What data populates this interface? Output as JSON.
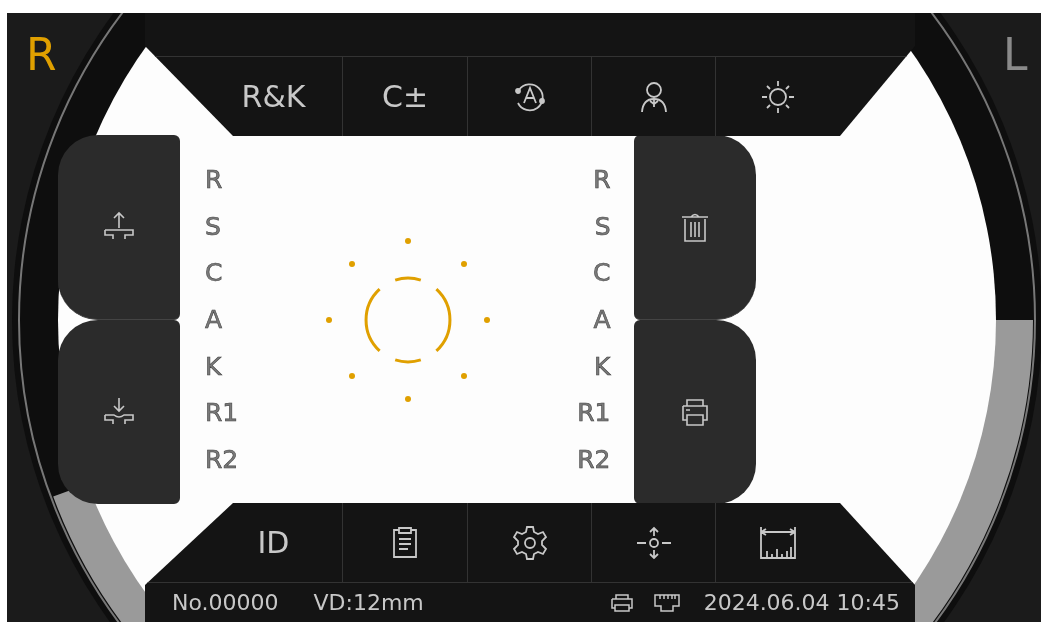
{
  "eyes": [
    {
      "label": "R",
      "selected": true
    },
    {
      "label": "L",
      "selected": false
    }
  ],
  "top_toolbar": [
    {
      "kind": "text",
      "label": "R&K"
    },
    {
      "kind": "text",
      "label": "C±"
    },
    {
      "kind": "icon"
    },
    {
      "kind": "icon"
    },
    {
      "kind": "icon"
    }
  ],
  "left_labels": [
    "R",
    "S",
    "C",
    "A",
    "K",
    "R1",
    "R2"
  ],
  "right_labels": [
    "R",
    "S",
    "C",
    "A",
    "K",
    "R1",
    "R2"
  ],
  "bottom_toolbar": [
    {
      "kind": "text",
      "label": "ID"
    },
    {
      "kind": "icon"
    },
    {
      "kind": "icon"
    },
    {
      "kind": "icon"
    },
    {
      "kind": "icon"
    }
  ],
  "status_bar": {
    "number": "No.00000",
    "vd": "VD:12mm",
    "datetime": "2024.06.04 10:45"
  }
}
